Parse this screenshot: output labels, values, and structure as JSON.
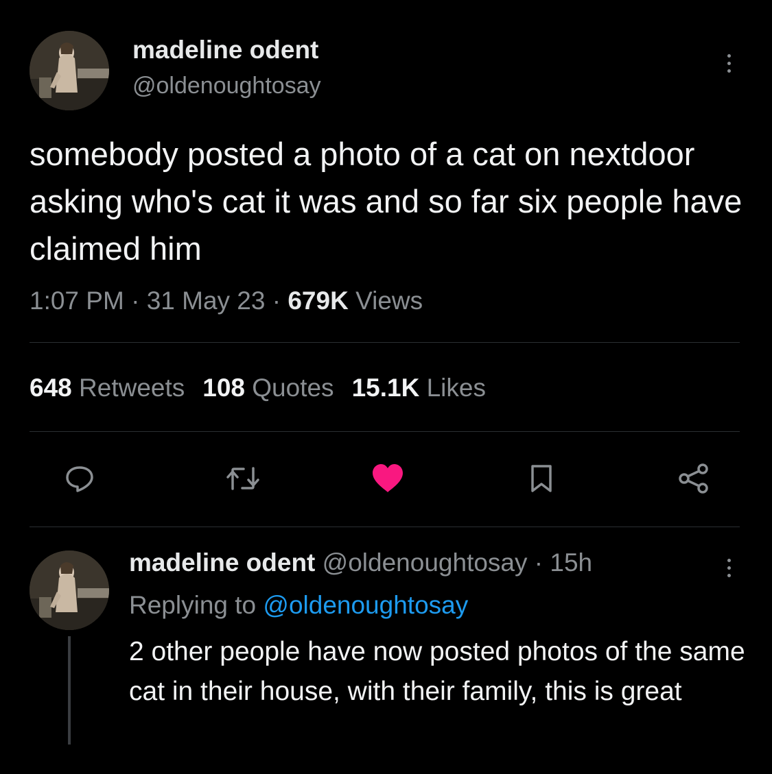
{
  "main_tweet": {
    "author_name": "madeline odent",
    "author_handle": "@oldenoughtosay",
    "text": "somebody posted a photo of a cat on nextdoor asking who's cat it was and so far six people have claimed him",
    "time": "1:07 PM",
    "separator": "·",
    "date": "31 May 23",
    "views_count": "679K",
    "views_label": "Views",
    "stats": {
      "retweets_count": "648",
      "retweets_label": "Retweets",
      "quotes_count": "108",
      "quotes_label": "Quotes",
      "likes_count": "15.1K",
      "likes_label": "Likes"
    },
    "actions": {
      "reply_icon": "speech-bubble-icon",
      "retweet_icon": "retweet-icon",
      "like_icon": "heart-icon",
      "like_color": "#f91880",
      "bookmark_icon": "bookmark-icon",
      "share_icon": "share-icon"
    }
  },
  "reply_tweet": {
    "author_name": "madeline odent",
    "author_handle": "@oldenoughtosay",
    "age": "15h",
    "separator": "·",
    "replying_prefix": "Replying to",
    "replying_handle": "@oldenoughtosay",
    "text": "2 other people have now posted photos of the same cat in their house, with their family, this is great"
  },
  "colors": {
    "background": "#000000",
    "primary_text": "#e7e9ea",
    "secondary_text": "#8b8f93",
    "link": "#1d9bf0",
    "divider": "#2b2f33"
  }
}
